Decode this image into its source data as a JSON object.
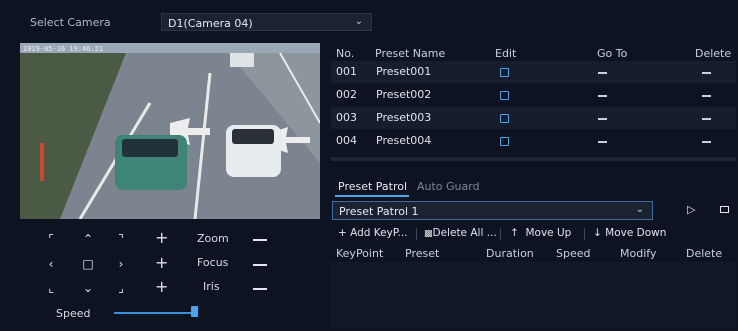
{
  "camera": {
    "label": "Select Camera",
    "selected": "D1(Camera 04)"
  },
  "video": {
    "timestamp": "2019-05-16 19:46:21"
  },
  "ptz": {
    "zoom_label": "Zoom",
    "focus_label": "Focus",
    "iris_label": "Iris",
    "speed_label": "Speed",
    "speed_value": 0.95
  },
  "preset_table": {
    "headers": {
      "no": "No.",
      "name": "Preset Name",
      "edit": "Edit",
      "goto": "Go To",
      "delete": "Delete"
    },
    "rows": [
      {
        "no": "001",
        "name": "Preset001"
      },
      {
        "no": "002",
        "name": "Preset002"
      },
      {
        "no": "003",
        "name": "Preset003"
      },
      {
        "no": "004",
        "name": "Preset004"
      }
    ]
  },
  "tabs": {
    "patrol": "Preset Patrol",
    "guard": "Auto Guard"
  },
  "patrol": {
    "selected": "Preset Patrol 1",
    "toolbar": {
      "add": "Add KeyP...",
      "delete_all": "Delete All ...",
      "move_up": "Move Up",
      "move_down": "Move Down"
    },
    "columns": {
      "keypoint": "KeyPoint",
      "preset": "Preset",
      "duration": "Duration",
      "speed": "Speed",
      "modify": "Modify",
      "delete": "Delete"
    }
  },
  "colors": {
    "accent": "#4da3e6",
    "background": "#0d1320"
  }
}
